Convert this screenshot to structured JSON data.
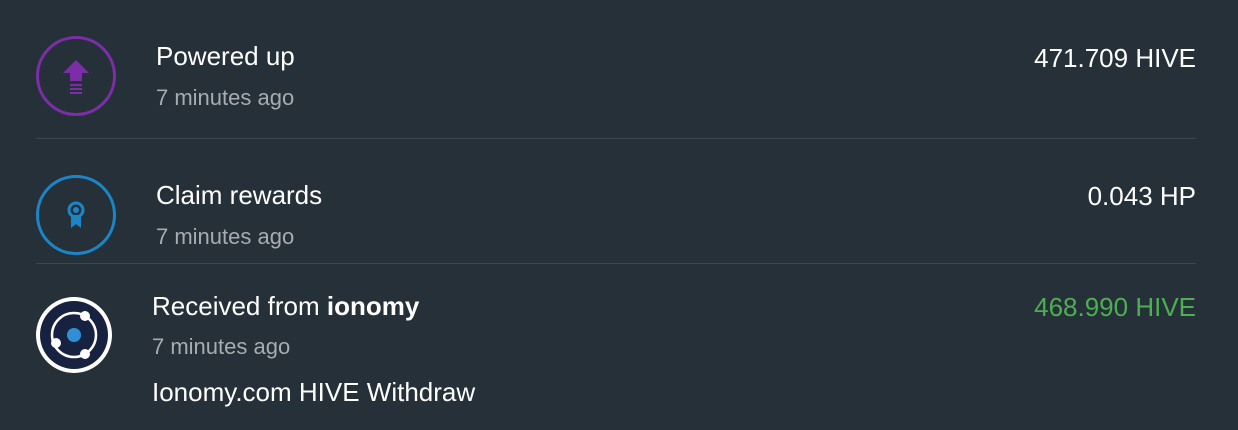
{
  "transactions": [
    {
      "title": "Powered up",
      "time": "7 minutes ago",
      "amount": "471.709 HIVE",
      "icon": "power-up-arrow-icon",
      "icon_color": "#7b2ea8"
    },
    {
      "title": "Claim rewards",
      "time": "7 minutes ago",
      "amount": "0.043 HP",
      "icon": "award-ribbon-icon",
      "icon_color": "#1a86c8"
    },
    {
      "title_prefix": "Received from",
      "sender": "ionomy",
      "time": "7 minutes ago",
      "memo": "Ionomy.com HIVE Withdraw",
      "amount": "468.990 HIVE",
      "amount_color": "#4caf50",
      "icon": "ionomy-avatar-icon"
    }
  ]
}
